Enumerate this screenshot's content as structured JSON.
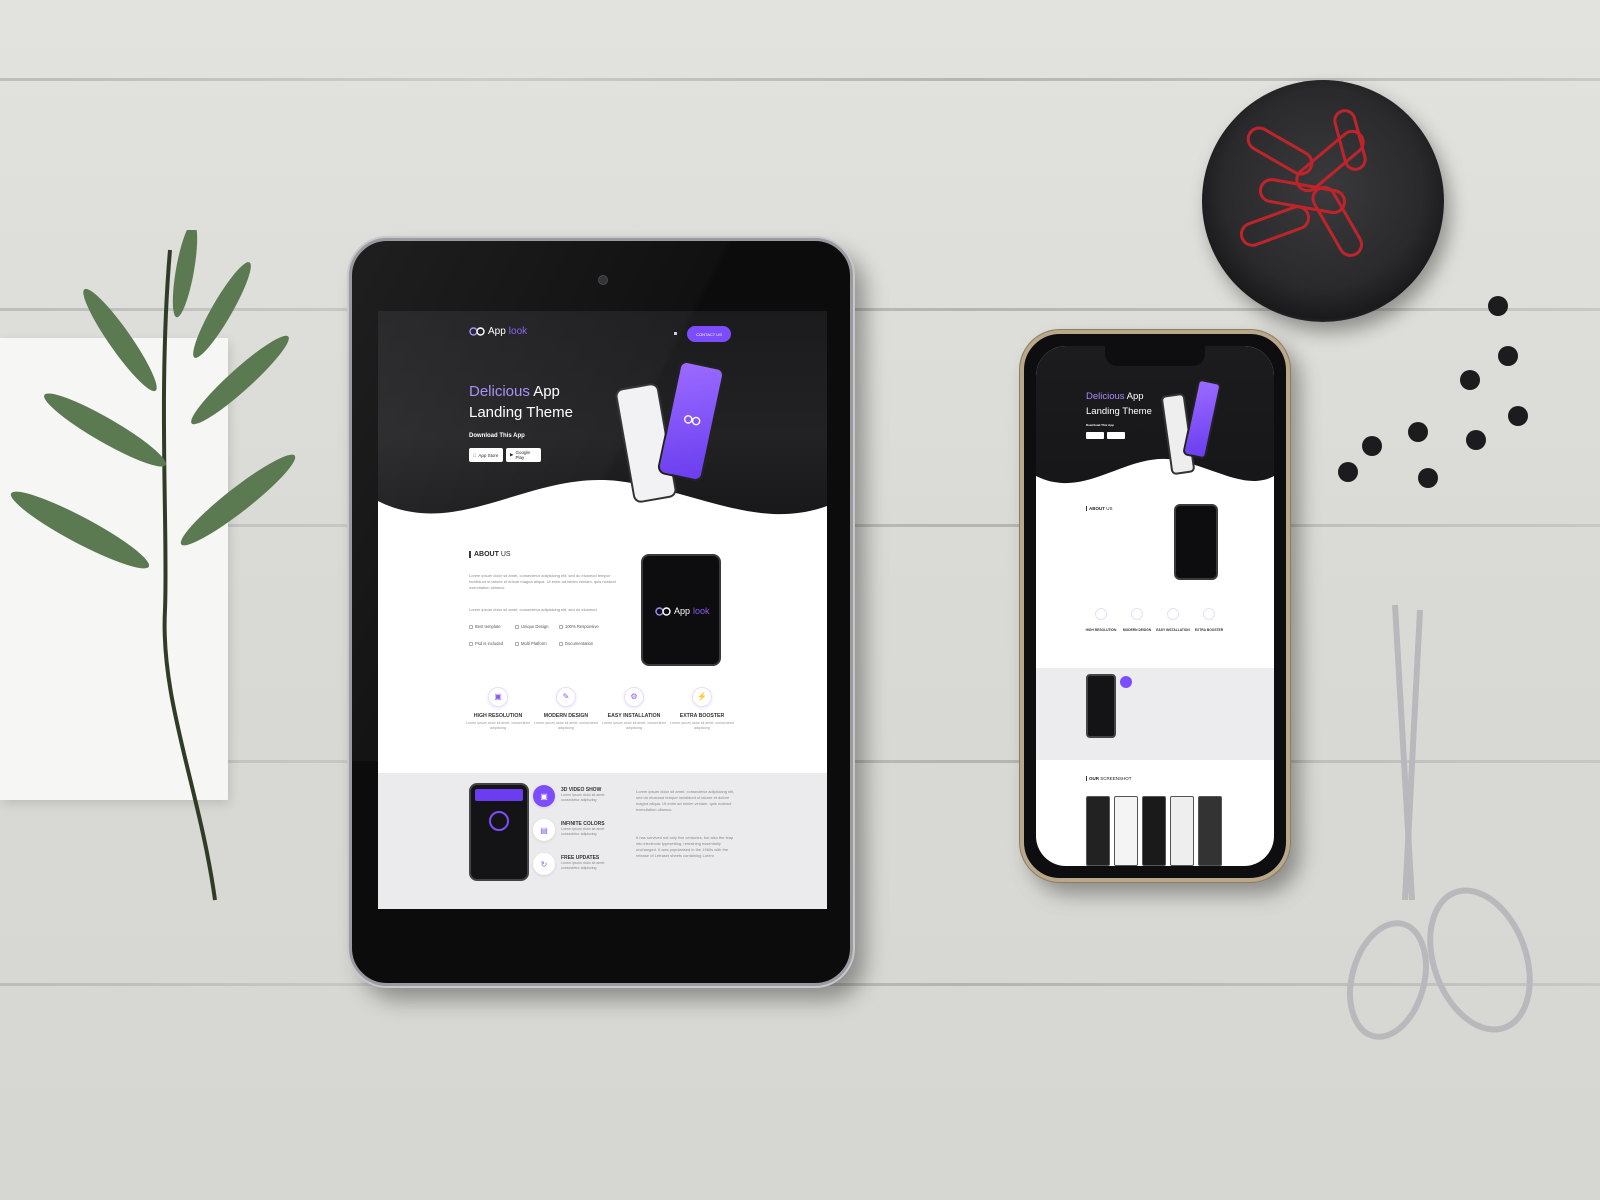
{
  "brand": {
    "name_prefix": "App",
    "name_suffix": "look",
    "accent_color": "#7c4dff"
  },
  "header": {
    "contact_label": "CONTACT US"
  },
  "hero": {
    "title_accent": "Delicious",
    "title_rest": " App",
    "title_line2": "Landing Theme",
    "download_label": "Download This App",
    "app_store_label": "App Store",
    "google_play_label": "Google Play"
  },
  "about": {
    "heading_bold": "ABOUT",
    "heading_rest": " US",
    "para1": "Lorem ipsum dolor sit amet, consectetur adipisicing elit, sed do eiusmod tempor incididunt ut labore et dolore magna aliqua. Ut enim ad minim veniam, quis nostrud exercitation ullamco.",
    "para2": "Lorem ipsum dolor sit amet, consectetur adipisicing elit, sed do eiusmod",
    "features": [
      "Best template",
      "Unique Design",
      "100% Responsive",
      "Psd is included",
      "Multi Platform",
      "Documentation"
    ]
  },
  "services": [
    {
      "icon": "resolution-icon",
      "title": "HIGH RESOLUTION",
      "text": "Lorem ipsum dolor sit amet, consectetur adipiscing"
    },
    {
      "icon": "design-icon",
      "title": "MODERN DESIGN",
      "text": "Lorem ipsum dolor sit amet, consectetur adipiscing"
    },
    {
      "icon": "install-icon",
      "title": "EASY INSTALLATION",
      "text": "Lorem ipsum dolor sit amet, consectetur adipiscing"
    },
    {
      "icon": "booster-icon",
      "title": "EXTRA BOOSTER",
      "text": "Lorem ipsum dolor sit amet, consectetur adipiscing"
    }
  ],
  "features_band": {
    "items": [
      {
        "title": "3D VIDEO SHOW",
        "text": "Lorem ipsum dolor sit amet consectetur adipiscing"
      },
      {
        "title": "INFINITE COLORS",
        "text": "Lorem ipsum dolor sit amet consectetur adipiscing"
      },
      {
        "title": "FREE UPDATES",
        "text": "Lorem ipsum dolor sit amet consectetur adipiscing"
      }
    ],
    "para1": "Lorem ipsum dolor sit amet, consectetur adipisicing elit, sed do eiusmod tempor incididunt ut labore et dolore magna aliqua. Ut enim ad minim veniam, quis nostrud exercitation ullamco.",
    "para2": "It has survived not only five centuries, but also the leap into electronic typesetting, remaining essentially unchanged. It was popularised in the 1960s with the release of Letraset sheets containing Lorem"
  },
  "phone_page": {
    "screenshot_heading_bold": "OUR",
    "screenshot_heading_rest": " SCREENSHOT"
  }
}
